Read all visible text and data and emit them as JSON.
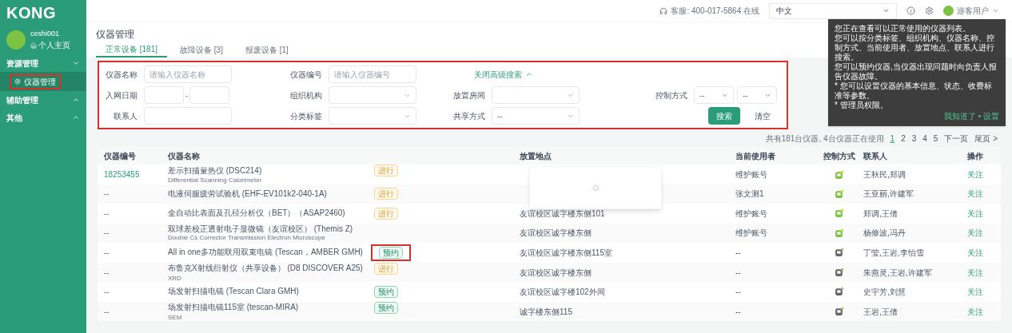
{
  "sidebar": {
    "logo": "KONG",
    "user": {
      "name": "ceshi001",
      "home_link": "个人主页"
    },
    "groups": [
      {
        "label": "资源管理",
        "expanded": true,
        "items": [
          {
            "label": "仪器管理",
            "selected": true,
            "highlighted": true
          }
        ]
      },
      {
        "label": "辅助管理",
        "expanded": false
      },
      {
        "label": "其他",
        "expanded": false
      }
    ]
  },
  "topbar": {
    "service": "客服: 400-017-5864 在线",
    "language": "中文",
    "user": "游客用户"
  },
  "tooltip": {
    "lines": [
      "您正在查看可以正常使用的仪器列表。",
      "您可以按分类标签、组织机构、仪器名称、控制方式、当前使用者、放置地点、联系人进行搜索。",
      "您可以预约仪器,当仪器出现问题时向负责人报告仪器故障。",
      "* 您可以设置仪器的基本信息、状态、收费标准等参数。",
      "* 管理员权限。"
    ],
    "footer": "我知道了 • 设置"
  },
  "page_title": "仪器管理",
  "tabs": [
    {
      "label": "正常设备 [181]",
      "selected": true
    },
    {
      "label": "故障设备 [3]",
      "selected": false
    },
    {
      "label": "报废设备 [1]",
      "selected": false
    }
  ],
  "filters": {
    "highlighted": true,
    "rows": [
      [
        {
          "kind": "input",
          "label": "仪器名称",
          "placeholder": "请输入仪器名称"
        },
        {
          "kind": "input",
          "label": "仪器编号",
          "placeholder": "请输入仪器编号"
        },
        {
          "kind": "link",
          "label": "关闭高级搜索"
        }
      ],
      [
        {
          "kind": "date_range",
          "label": "入网日期",
          "separator": "-"
        },
        {
          "kind": "select",
          "label": "组织机构"
        },
        {
          "kind": "select",
          "label": "放置房间"
        },
        {
          "kind": "select_pair",
          "label": "控制方式",
          "values": [
            "--",
            "--"
          ]
        }
      ],
      [
        {
          "kind": "input",
          "label": "联系人"
        },
        {
          "kind": "select",
          "label": "分类标签"
        },
        {
          "kind": "select",
          "label": "共享方式",
          "value": "--"
        },
        {
          "kind": "buttons",
          "buttons": [
            {
              "label": "搜索",
              "primary": true
            },
            {
              "label": "清空",
              "primary": false
            }
          ]
        }
      ]
    ]
  },
  "summary": "共有181台仪器, 4台仪器正在使用",
  "pagination": {
    "pages": [
      {
        "label": "1",
        "selected": true
      },
      {
        "label": "2",
        "selected": false
      },
      {
        "label": "3",
        "selected": false
      },
      {
        "label": "4",
        "selected": false
      },
      {
        "label": "5",
        "selected": false
      }
    ],
    "next": "下一页",
    "last": "尾页 >"
  },
  "table": {
    "columns": [
      "仪器编号",
      "仪器名称",
      "放置地点",
      "当前使用者",
      "控制方式",
      "联系人",
      "操作"
    ],
    "loading_popover": true,
    "rows": [
      {
        "id": "18253455",
        "name": "差示扫描量热仪 (DSC214)",
        "tag": {
          "label": "进行",
          "kind": "busy",
          "highlighted": false
        },
        "subtitle": "Differential Scanning Calorimeter",
        "user": "维护账号",
        "online": true,
        "contacts": "王秋民,郑调",
        "action": "关注"
      },
      {
        "id": "--",
        "name": "电液伺服疲劳试验机 (EHF-EV101k2-040-1A)",
        "tag": {
          "label": "进行",
          "kind": "busy",
          "highlighted": false
        },
        "user": "张文测1",
        "online": true,
        "contacts": "王亚丽,许建军",
        "action": "关注"
      },
      {
        "id": "--",
        "name": "全自动比表面及孔径分析仪（BET）（ASAP2460)",
        "tag": {
          "label": "进行",
          "kind": "busy",
          "highlighted": false
        },
        "location": "友谊校区诚字楼东侧101",
        "user": "维护账号",
        "online": true,
        "contacts": "郑调,王倩",
        "action": "关注"
      },
      {
        "id": "--",
        "name": "双球差校正透射电子显微镜（友谊校区） (Themis Z)",
        "subtitle": "Double Cs Corrector Transmission Electron Microscope",
        "location": "友谊校区诚字楼东侧",
        "user": "维护账号",
        "online": true,
        "contacts": "杨修波,冯丹",
        "action": "关注"
      },
      {
        "id": "--",
        "name": "All in one多功能联用双束电镜 (Tescan，AMBER GMH)",
        "tag": {
          "label": "预约",
          "kind": "book",
          "highlighted": true
        },
        "location": "友谊校区诚字楼东侧115室",
        "user": "--",
        "online": false,
        "contacts": "丁莹,王岩,李怡雪",
        "action": "关注"
      },
      {
        "id": "--",
        "name": "布鲁克X射线衍射仪（共享设备） (D8 DISCOVER A25)",
        "tag": {
          "label": "进行",
          "kind": "busy",
          "highlighted": false
        },
        "subtitle": "XRD",
        "location": "友谊校区诚字楼东侧",
        "user": "--",
        "online": false,
        "contacts": "朱燕灵,王岩,许建军",
        "action": "关注"
      },
      {
        "id": "--",
        "name": "场发射扫描电镜 (Tescan Clara GMH)",
        "tag": {
          "label": "预约",
          "kind": "book",
          "highlighted": false
        },
        "location": "友谊校区诚字楼102外间",
        "user": "--",
        "online": false,
        "contacts": "史宇芳,刘慧",
        "action": "关注"
      },
      {
        "id": "--",
        "name": "场发射扫描电镜115室 (tescan-MIRA)",
        "tag": {
          "label": "预约",
          "kind": "book",
          "highlighted": false
        },
        "subtitle": "SEM",
        "location": "诚字楼东侧115",
        "user": "--",
        "online": false,
        "contacts": "王岩,王倩",
        "action": "关注"
      }
    ]
  }
}
